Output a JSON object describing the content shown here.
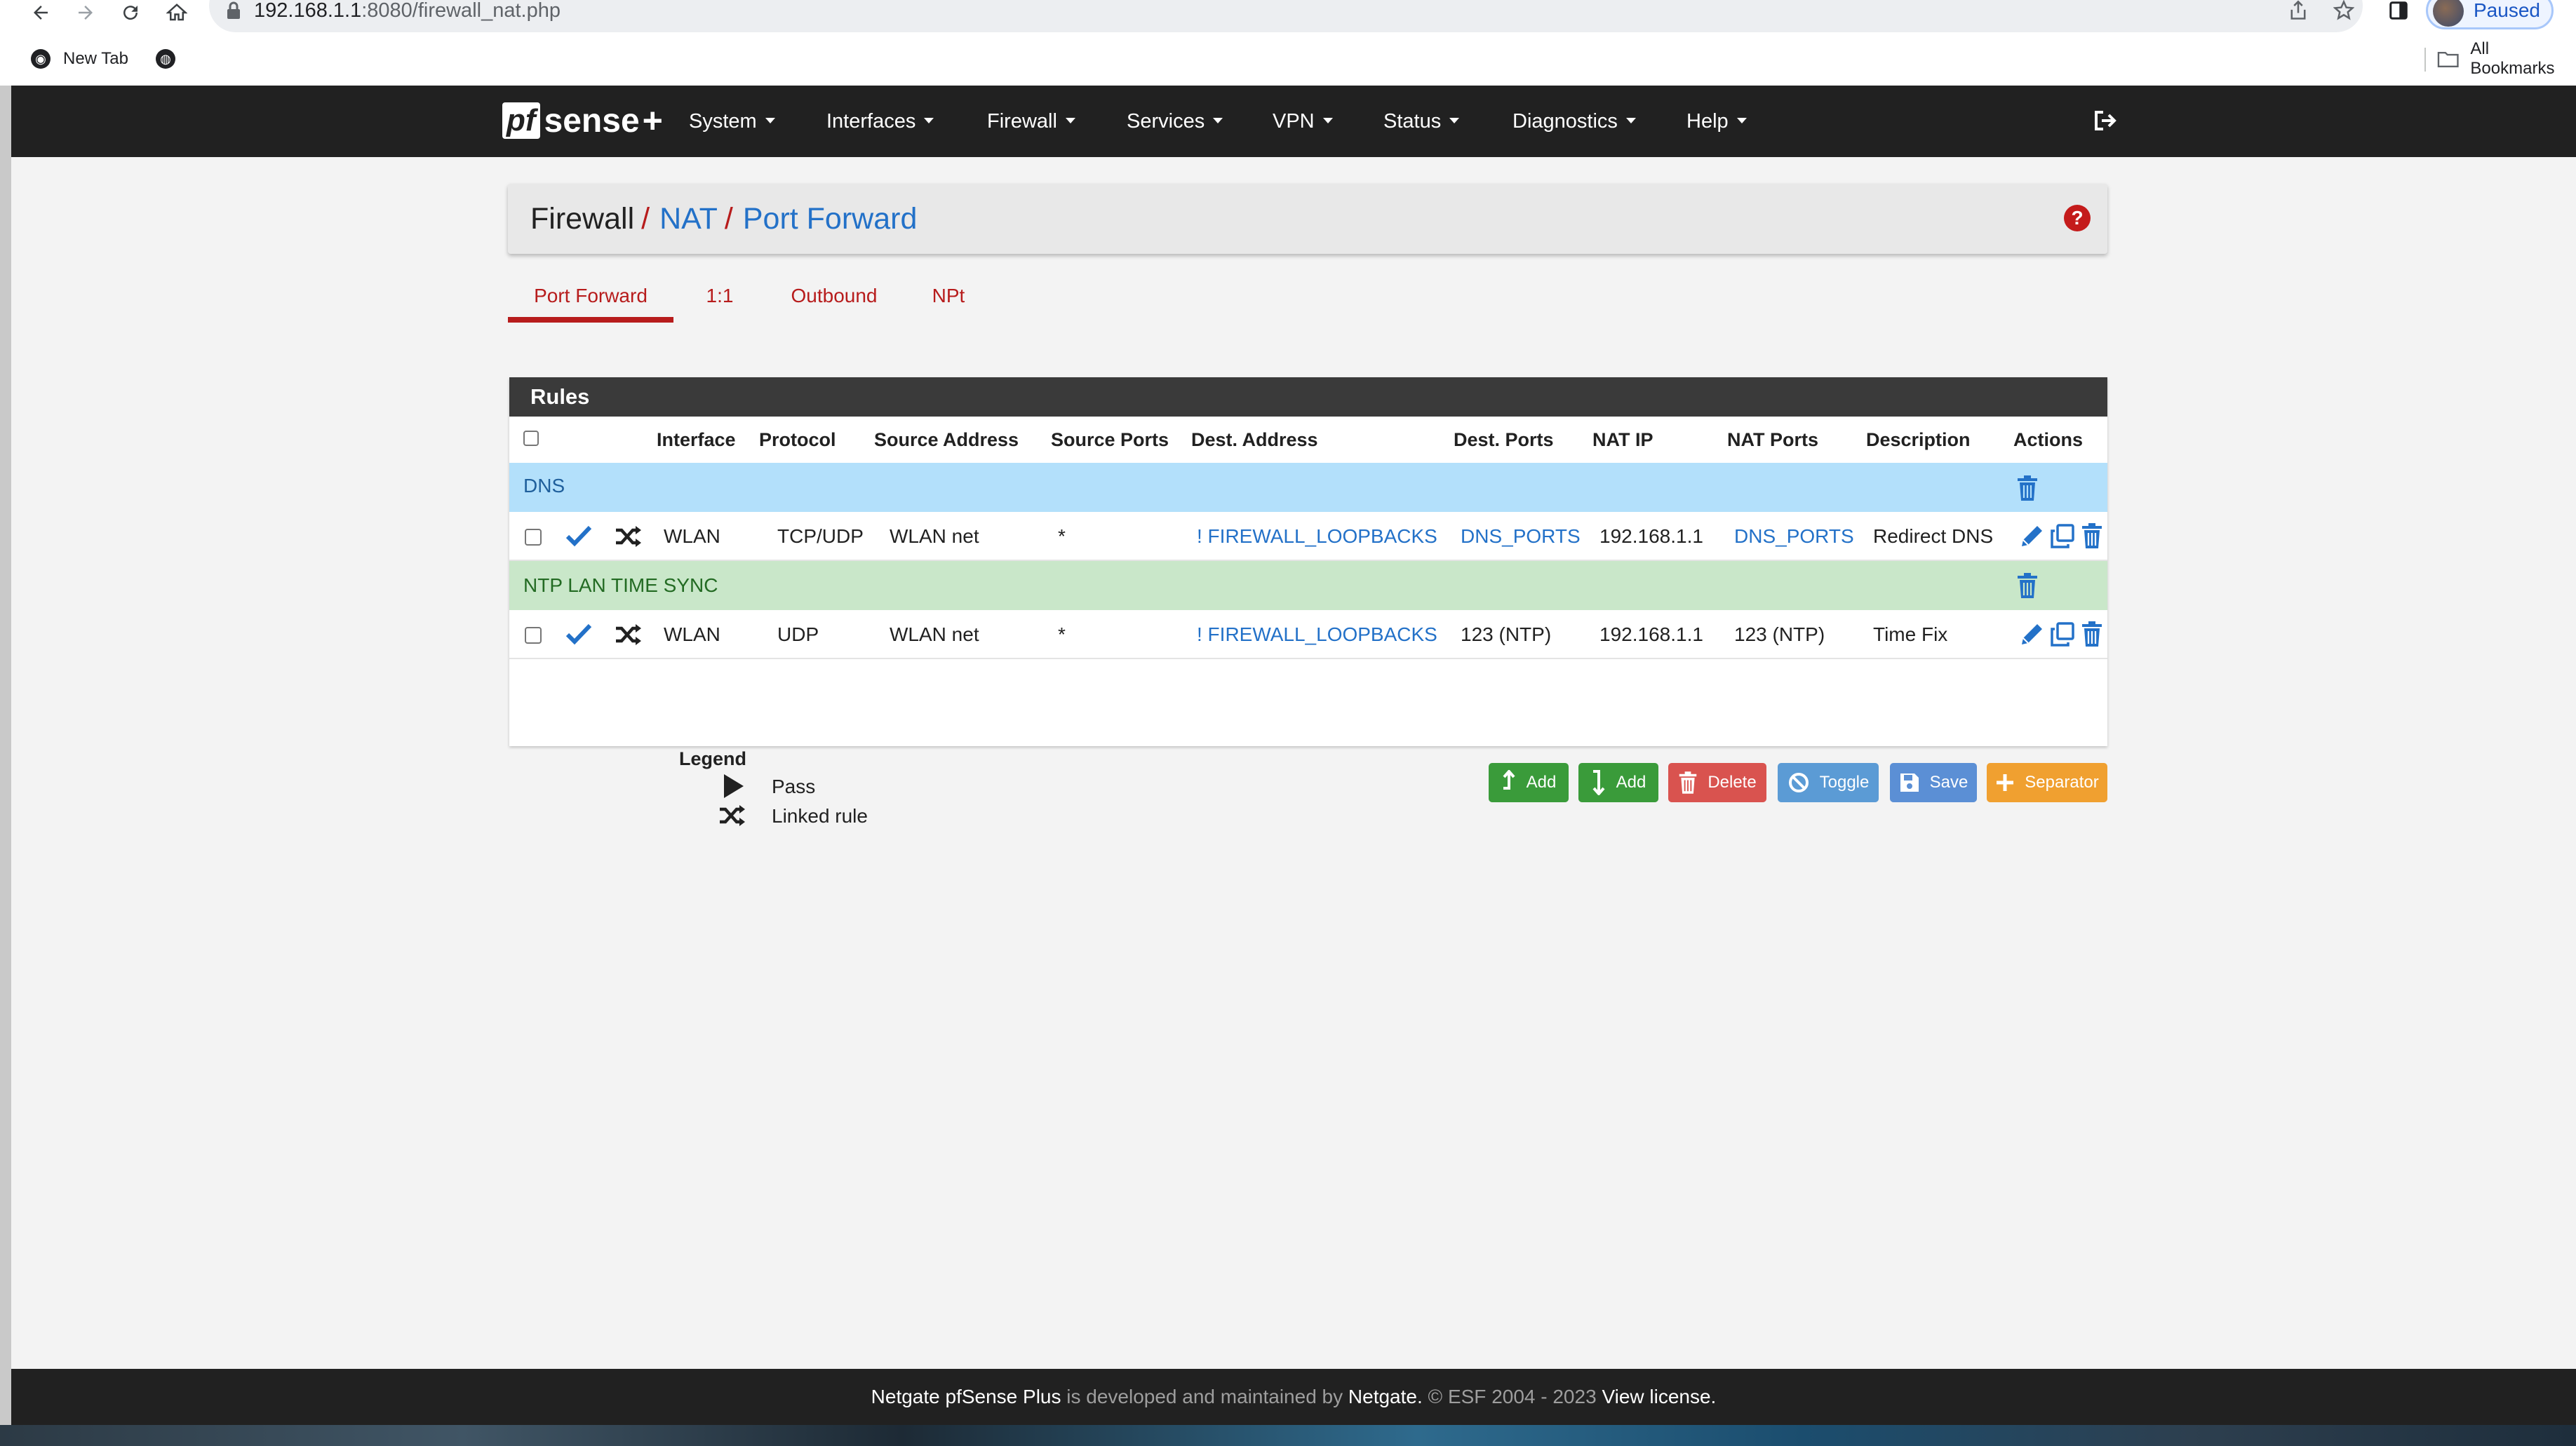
{
  "browser": {
    "url_host": "192.168.1.1",
    "url_path": ":8080/firewall_nat.php",
    "profile_label": "Paused",
    "bookmarks": [
      {
        "label": "New Tab"
      }
    ],
    "all_bookmarks_label": "All Bookmarks"
  },
  "navbar": {
    "logo": {
      "pf": "pf",
      "sense": "sense",
      "plus": "+"
    },
    "menus": [
      "System",
      "Interfaces",
      "Firewall",
      "Services",
      "VPN",
      "Status",
      "Diagnostics",
      "Help"
    ]
  },
  "breadcrumb": {
    "root": "Firewall",
    "sep": "/",
    "level1": "NAT",
    "level2": "Port Forward",
    "help_glyph": "?"
  },
  "tabs": [
    {
      "label": "Port Forward",
      "active": true
    },
    {
      "label": "1:1",
      "active": false
    },
    {
      "label": "Outbound",
      "active": false
    },
    {
      "label": "NPt",
      "active": false
    }
  ],
  "rules": {
    "heading": "Rules",
    "columns": [
      "Interface",
      "Protocol",
      "Source Address",
      "Source Ports",
      "Dest. Address",
      "Dest. Ports",
      "NAT IP",
      "NAT Ports",
      "Description",
      "Actions"
    ],
    "separators": [
      {
        "label": "DNS",
        "color": "#b3e0fb"
      },
      {
        "label": "NTP LAN TIME SYNC",
        "color": "#c9e7c9"
      }
    ],
    "rows": [
      {
        "interface": "WLAN",
        "protocol": "TCP/UDP",
        "source_address": "WLAN net",
        "source_ports": "*",
        "dest_address": "! FIREWALL_LOOPBACKS",
        "dest_ports": "DNS_PORTS",
        "nat_ip": "192.168.1.1",
        "nat_ports": "DNS_PORTS",
        "description": "Redirect DNS",
        "status_icon": "check-icon",
        "linked_icon": "shuffle-icon"
      },
      {
        "interface": "WLAN",
        "protocol": "UDP",
        "source_address": "WLAN net",
        "source_ports": "*",
        "dest_address": "! FIREWALL_LOOPBACKS",
        "dest_ports": "123 (NTP)",
        "nat_ip": "192.168.1.1",
        "nat_ports": "123 (NTP)",
        "description": "Time Fix",
        "status_icon": "check-icon",
        "linked_icon": "shuffle-icon"
      }
    ]
  },
  "buttons": {
    "add_top": "Add",
    "add_bottom": "Add",
    "delete": "Delete",
    "toggle": "Toggle",
    "save": "Save",
    "separator": "Separator"
  },
  "legend": {
    "title": "Legend",
    "items": [
      {
        "icon": "play-icon",
        "label": "Pass"
      },
      {
        "icon": "shuffle-icon",
        "label": "Linked rule"
      }
    ]
  },
  "footer": {
    "product": "Netgate pfSense Plus",
    "middle": "is developed and maintained by",
    "company": "Netgate.",
    "copyright": "© ESF 2004 - 2023",
    "license": "View license."
  },
  "colors": {
    "navbar_bg": "#212121",
    "brand_red": "#b71c1c",
    "link_blue": "#2371c8",
    "btn_success": "#3a9b3a",
    "btn_danger": "#d9534f",
    "btn_info": "#5b9bd5",
    "btn_primary": "#5b8fd5",
    "btn_warning": "#f0a030"
  }
}
